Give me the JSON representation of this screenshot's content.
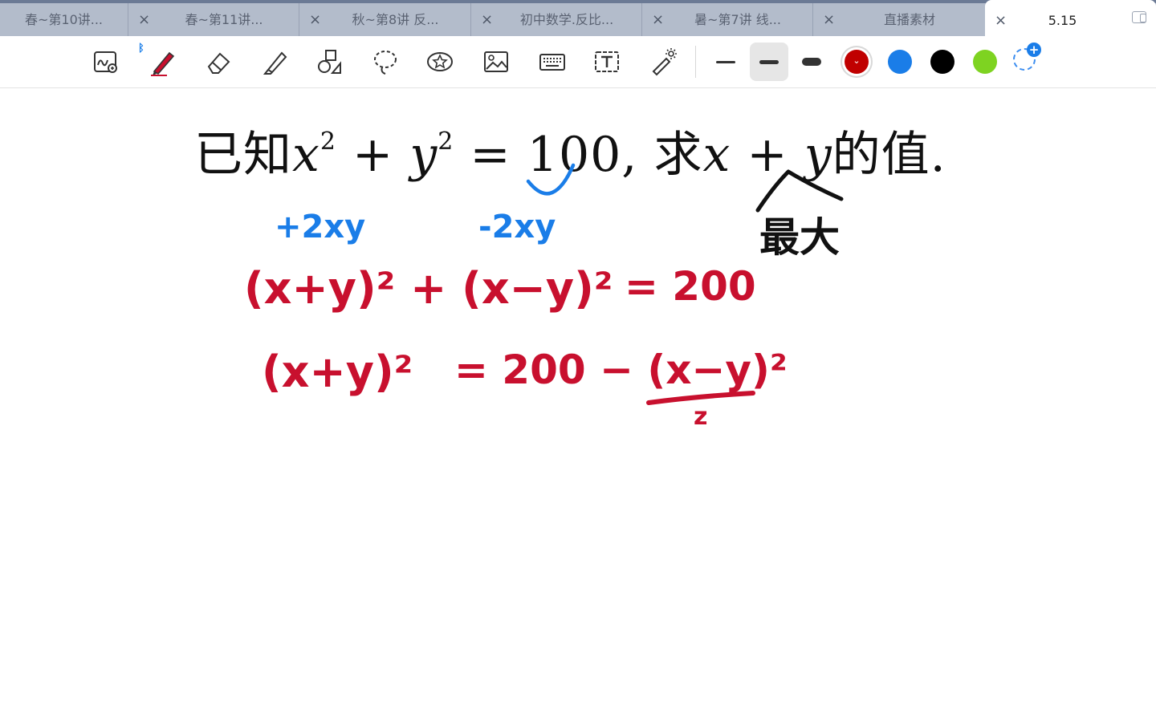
{
  "tabs": [
    {
      "label": "春~第10讲...",
      "close": ""
    },
    {
      "label": "春~第11讲...",
      "close": "×"
    },
    {
      "label": "秋~第8讲  反...",
      "close": "×"
    },
    {
      "label": "初中数学.反比...",
      "close": "×"
    },
    {
      "label": "暑~第7讲  线...",
      "close": "×"
    },
    {
      "label": "直播素材",
      "close": "×"
    },
    {
      "label": "5.15",
      "close": "×",
      "active": true
    }
  ],
  "toolbar": {
    "tools": [
      "zoom-draw",
      "pen",
      "eraser",
      "highlighter",
      "shapes",
      "lasso",
      "sticker",
      "image",
      "keyboard",
      "text",
      "laser-pointer"
    ],
    "bluetooth_mark": "ᛒ",
    "selected_tool": "pen",
    "thickness_selected": "medium",
    "colors": [
      "#c00000",
      "#1a7de8",
      "#000000",
      "#7ed321"
    ],
    "selected_color": "#c00000",
    "add_color": "+"
  },
  "question": {
    "prefix": "已知",
    "var_x": "x",
    "exp1": "2",
    "plus": " + ",
    "var_y": "y",
    "exp2": "2",
    "equals": " = 100, 求",
    "sum": "x + y",
    "suffix": "的值."
  },
  "handwriting": {
    "blue_left": "+2xy",
    "blue_right": "-2xy",
    "black_note": "最大",
    "line1_lhs": "(x+y)² + (x−y)²",
    "line1_rhs": "= 200",
    "line2_lhs": "(x+y)²",
    "line2_rhs": "= 200 − (x−y)²",
    "line2_under": "z"
  }
}
